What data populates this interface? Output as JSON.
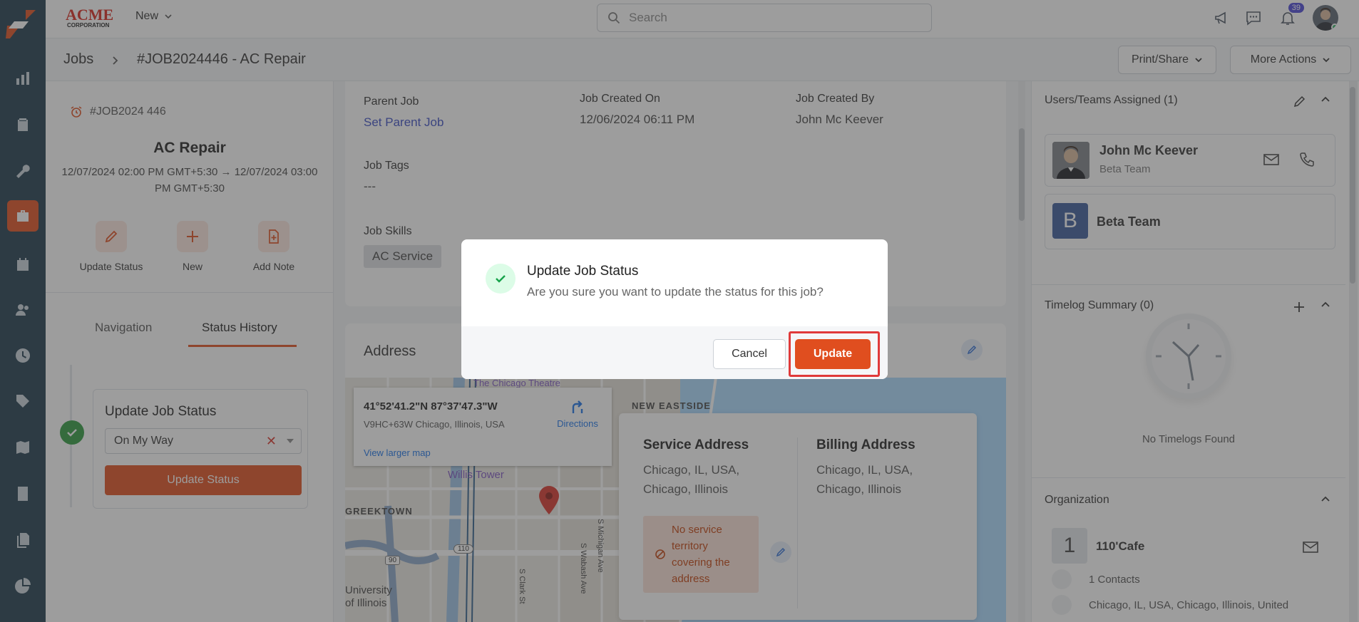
{
  "app": {
    "brand": "ACME CORPORATION",
    "brand_word": "ACME",
    "brand_sub": "CORPORATION",
    "new_label": "New",
    "search_placeholder": "Search",
    "notification_count": "39",
    "accent": "#e04e1f",
    "rail_color": "#1e3a4c"
  },
  "rail": {
    "items": [
      {
        "icon": "chart-bar-icon"
      },
      {
        "icon": "clipboard-check-icon"
      },
      {
        "icon": "wrench-icon"
      },
      {
        "icon": "briefcase-icon",
        "active": true
      },
      {
        "icon": "calendar-icon"
      },
      {
        "icon": "users-icon"
      },
      {
        "icon": "clock-icon"
      },
      {
        "icon": "tag-icon"
      },
      {
        "icon": "map-icon"
      },
      {
        "icon": "calculator-icon"
      },
      {
        "icon": "documents-icon"
      },
      {
        "icon": "pie-chart-icon"
      }
    ]
  },
  "header": {
    "crumb_root": "Jobs",
    "crumb_current": "#JOB2024446 - AC Repair",
    "print_share": "Print/Share",
    "more_actions": "More Actions"
  },
  "left": {
    "job_id": "#JOB2024 446",
    "title": "AC Repair",
    "dates": "12/07/2024 02:00 PM GMT+5:30 → 12/07/2024 03:00 PM GMT+5:30",
    "actions": [
      "Update Status",
      "New",
      "Add Note"
    ],
    "tabs": [
      "Navigation",
      "Status History"
    ],
    "status_card": {
      "heading": "Update Job Status",
      "selected": "On My Way",
      "button": "Update Status"
    }
  },
  "details": {
    "parent_job_label": "Parent Job",
    "parent_job_value": "Set Parent Job",
    "created_on_label": "Job Created On",
    "created_on_value": "12/06/2024 06:11 PM",
    "created_by_label": "Job Created By",
    "created_by_value": "John Mc Keever",
    "tags_label": "Job Tags",
    "tags_value": "---",
    "skills_label": "Job Skills",
    "skill_chip": "AC Service"
  },
  "address": {
    "heading": "Address",
    "map": {
      "coords": "41°52'41.2\"N 87°37'47.3\"W",
      "plus_code": "V9HC+63W Chicago, Illinois, USA",
      "directions": "Directions",
      "larger_map": "View larger map",
      "labels": [
        "The Chicago Theatre",
        "NEW EASTSIDE",
        "Willis Tower",
        "GREEKTOWN",
        "University of Illinois",
        "S Clark St",
        "S Wabash Ave",
        "S Michigan Ave"
      ],
      "road_shields": [
        "90",
        "110"
      ]
    },
    "service_heading": "Service Address",
    "service_text": [
      "Chicago, IL, USA,",
      "Chicago, Illinois"
    ],
    "billing_heading": "Billing Address",
    "billing_text": [
      "Chicago, IL, USA,",
      "Chicago, Illinois"
    ],
    "warning": [
      "No service",
      "territory",
      "covering the",
      "address"
    ]
  },
  "right": {
    "assigned_heading": "Users/Teams Assigned (1)",
    "user_name": "John Mc Keever",
    "user_team": "Beta Team",
    "team_initial": "B",
    "team_name": "Beta Team",
    "timelog_heading": "Timelog Summary (0)",
    "timelog_empty": "No Timelogs Found",
    "org_heading": "Organization",
    "org_initial": "1",
    "org_name": "110'Cafe",
    "org_contacts": "1 Contacts",
    "org_address": "Chicago, IL, USA, Chicago, Illinois, United"
  },
  "modal": {
    "title": "Update Job Status",
    "message": "Are you sure you want to update the status for this job?",
    "cancel": "Cancel",
    "update": "Update",
    "highlight_color": "#e03a3a"
  }
}
